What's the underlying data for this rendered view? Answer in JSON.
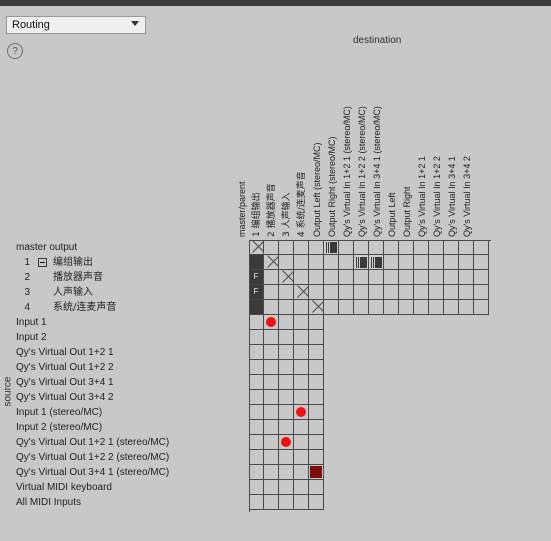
{
  "window": {
    "mode_select_value": "Routing",
    "help_icon": "question-circle-icon",
    "destination_label": "destination",
    "source_label": "source"
  },
  "columns": [
    {
      "label": "master/parent",
      "cjk": false
    },
    {
      "label": "1  编组输出",
      "cjk": true
    },
    {
      "label": "2  播放器声音",
      "cjk": true
    },
    {
      "label": "3  人声输入",
      "cjk": true
    },
    {
      "label": "4  系统/连麦声音",
      "cjk": true
    },
    {
      "label": "Output Left (stereo/MC)",
      "cjk": false
    },
    {
      "label": "Output Right (stereo/MC)",
      "cjk": false
    },
    {
      "label": "Qy's Virtual In 1+2 1 (stereo/MC)",
      "cjk": false
    },
    {
      "label": "Qy's Virtual In 1+2 2 (stereo/MC)",
      "cjk": false
    },
    {
      "label": "Qy's Virtual In 3+4 1 (stereo/MC)",
      "cjk": false
    },
    {
      "label": "Output Left",
      "cjk": false
    },
    {
      "label": "Output Right",
      "cjk": false
    },
    {
      "label": "Qy's Virtual In 1+2 1",
      "cjk": false
    },
    {
      "label": "Qy's Virtual In 1+2 2",
      "cjk": false
    },
    {
      "label": "Qy's Virtual In 3+4 1",
      "cjk": false
    },
    {
      "label": "Qy's Virtual In 3+4 2",
      "cjk": false
    }
  ],
  "rows": [
    {
      "kind": "plain",
      "label": "master output",
      "num": "",
      "cells": 16
    },
    {
      "kind": "child",
      "num": "1",
      "label": "编组输出",
      "node": true,
      "cells": 16
    },
    {
      "kind": "child",
      "num": "2",
      "label": "播放器声音",
      "node": false,
      "cells": 16
    },
    {
      "kind": "child",
      "num": "3",
      "label": "人声输入",
      "node": false,
      "cells": 16
    },
    {
      "kind": "child",
      "num": "4",
      "label": "系统/连麦声音",
      "node": false,
      "cells": 16
    },
    {
      "kind": "plain",
      "label": "Input 1",
      "num": "",
      "cells": 5
    },
    {
      "kind": "plain",
      "label": "Input 2",
      "num": "",
      "cells": 5
    },
    {
      "kind": "plain",
      "label": "Qy's Virtual Out 1+2 1",
      "num": "",
      "cells": 5
    },
    {
      "kind": "plain",
      "label": "Qy's Virtual Out 1+2 2",
      "num": "",
      "cells": 5
    },
    {
      "kind": "plain",
      "label": "Qy's Virtual Out 3+4 1",
      "num": "",
      "cells": 5
    },
    {
      "kind": "plain",
      "label": "Qy's Virtual Out 3+4 2",
      "num": "",
      "cells": 5
    },
    {
      "kind": "plain",
      "label": "Input 1 (stereo/MC)",
      "num": "",
      "cells": 5
    },
    {
      "kind": "plain",
      "label": "Input 2 (stereo/MC)",
      "num": "",
      "cells": 5
    },
    {
      "kind": "plain",
      "label": "Qy's Virtual Out 1+2 1 (stereo/MC)",
      "num": "",
      "cells": 5
    },
    {
      "kind": "plain",
      "label": "Qy's Virtual Out 1+2 2 (stereo/MC)",
      "num": "",
      "cells": 5
    },
    {
      "kind": "plain",
      "label": "Qy's Virtual Out 3+4 1 (stereo/MC)",
      "num": "",
      "cells": 5
    },
    {
      "kind": "plain",
      "label": "Virtual MIDI keyboard",
      "num": "",
      "cells": 5
    },
    {
      "kind": "plain",
      "label": "All MIDI Inputs",
      "num": "",
      "cells": 5
    }
  ],
  "markers": [
    {
      "row": 0,
      "col": 0,
      "type": "x"
    },
    {
      "row": 0,
      "col": 5,
      "type": "midi"
    },
    {
      "row": 1,
      "col": 0,
      "type": "dark"
    },
    {
      "row": 1,
      "col": 1,
      "type": "x"
    },
    {
      "row": 1,
      "col": 7,
      "type": "midi"
    },
    {
      "row": 1,
      "col": 8,
      "type": "midi"
    },
    {
      "row": 2,
      "col": 0,
      "type": "f",
      "text": "F"
    },
    {
      "row": 2,
      "col": 2,
      "type": "x"
    },
    {
      "row": 3,
      "col": 0,
      "type": "f",
      "text": "F"
    },
    {
      "row": 3,
      "col": 3,
      "type": "x"
    },
    {
      "row": 4,
      "col": 0,
      "type": "dark"
    },
    {
      "row": 4,
      "col": 4,
      "type": "x"
    },
    {
      "row": 5,
      "col": 1,
      "type": "dot"
    },
    {
      "row": 11,
      "col": 3,
      "type": "dot"
    },
    {
      "row": 13,
      "col": 2,
      "type": "dot"
    },
    {
      "row": 15,
      "col": 4,
      "type": "square"
    }
  ],
  "colors": {
    "background": "#c8c8c8",
    "titlebar": "#3b3b3b",
    "grid_line": "#4a4a4a",
    "marker_dark": "#3a3a3a",
    "marker_red": "#ee1111",
    "marker_dark_red": "#7d0f0f"
  }
}
